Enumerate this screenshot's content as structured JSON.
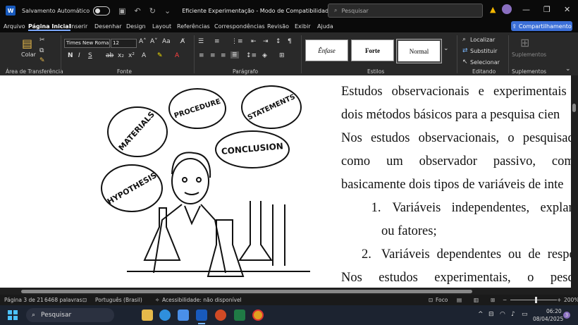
{
  "titlebar": {
    "app_icon": "W",
    "autosave_label": "Salvamento Automático",
    "doc_title": "Eficiente Experimentação  -  Modo de Compatibilidade  •  Salvo ⌄",
    "search_placeholder": "Pesquisar"
  },
  "menu": {
    "items": [
      "Arquivo",
      "Página Inicial",
      "Inserir",
      "Desenhar",
      "Design",
      "Layout",
      "Referências",
      "Correspondências",
      "Revisão",
      "Exibir",
      "Ajuda"
    ],
    "active": "Página Inicial",
    "share_label": "Compartilhamento"
  },
  "ribbon": {
    "paste_label": "Colar",
    "font_name": "Times New Roman",
    "font_size": "12",
    "styles": [
      "Ênfase",
      "Forte",
      "Normal"
    ],
    "find_label": "Localizar",
    "replace_label": "Substituir",
    "select_label": "Selecionar",
    "addins_label": "Suplementos",
    "groups": [
      "Área de Transferência",
      "Fonte",
      "Parágrafo",
      "Estilos",
      "Editando",
      "Suplementos"
    ]
  },
  "document": {
    "lines": [
      {
        "type": "just",
        "words": [
          "Estudos",
          "observacionais",
          "e",
          "experimentais",
          "s"
        ]
      },
      {
        "type": "plain",
        "text": "dois métodos básicos para a pesquisa cien"
      },
      {
        "type": "just",
        "words": [
          "Nos",
          "estudos",
          "observacionais,",
          "o",
          "pesquisado"
        ]
      },
      {
        "type": "just",
        "words": [
          "como",
          "um",
          "observador",
          "passivo,",
          "comp"
        ]
      },
      {
        "type": "plain",
        "text": "basicamente dois tipos de variáveis de inte"
      },
      {
        "type": "list",
        "num": "1.",
        "words": [
          "Variáveis",
          "independentes,",
          "explana"
        ]
      },
      {
        "type": "indent",
        "text": "ou fatores;"
      },
      {
        "type": "list",
        "num": "2.",
        "words": [
          "Variáveis",
          "dependentes",
          "ou",
          "de",
          "respos"
        ]
      },
      {
        "type": "just",
        "words": [
          "Nos",
          "estudos",
          "experimentais,",
          "o",
          "pesqu"
        ]
      }
    ],
    "illustration_words": [
      "MATERIALS",
      "PROCEDURE",
      "STATEMENTS",
      "CONCLUSION",
      "HYPOTHESIS"
    ]
  },
  "status": {
    "page": "Página 3 de 21",
    "words": "6468 palavras",
    "language": "Português (Brasil)",
    "accessibility": "Acessibilidade: não disponível",
    "focus": "Foco",
    "zoom": "200%"
  },
  "taskbar": {
    "search_label": "Pesquisar",
    "time": "06:20",
    "date": "08/04/2025",
    "notification_count": "3"
  }
}
